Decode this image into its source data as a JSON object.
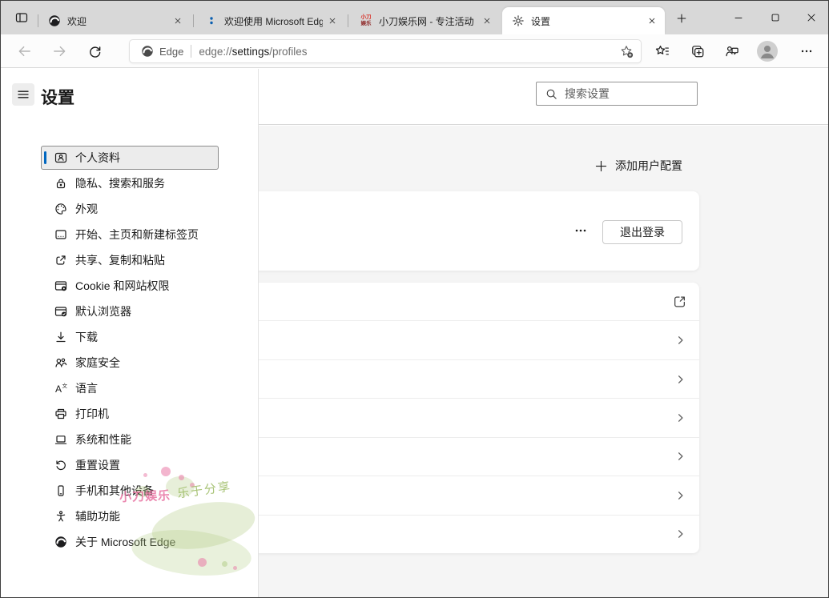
{
  "browser": {
    "tab_actions_icon": "tab-actions-icon",
    "tabs": [
      {
        "title": "欢迎",
        "icon": "edge-logo-icon",
        "active": false
      },
      {
        "title": "欢迎使用 Microsoft Edg",
        "icon": "blue-dots-favicon",
        "active": false
      },
      {
        "title": "小刀娱乐网 - 专注活动",
        "icon": "xiaodao-favicon",
        "favicon_top": "小刀",
        "favicon_bottom": "娱乐",
        "active": false
      },
      {
        "title": "设置",
        "icon": "gear-icon",
        "active": true
      }
    ],
    "window_controls": [
      {
        "name": "minimize-icon"
      },
      {
        "name": "maximize-icon"
      },
      {
        "name": "close-icon"
      }
    ],
    "address": {
      "back_icon": "back-arrow-icon",
      "forward_icon": "forward-arrow-icon",
      "refresh_icon": "refresh-icon",
      "site_icon": "edge-logo-icon",
      "site_label": "Edge",
      "url_prefix": "edge://",
      "url_emphasis": "settings",
      "url_suffix": "/profiles",
      "add_favorite_icon": "star-plus-icon"
    },
    "toolbar_icons": [
      {
        "name": "favorites-icon"
      },
      {
        "name": "collections-icon"
      },
      {
        "name": "browser-essentials-icon"
      },
      {
        "name": "profile-avatar-icon"
      },
      {
        "name": "more-options-icon"
      }
    ]
  },
  "settings": {
    "title": "设置",
    "menu_icon": "hamburger-icon",
    "search_placeholder": "搜索设置",
    "search_icon": "search-icon",
    "nav": [
      {
        "label": "个人资料",
        "icon": "profile-card-icon",
        "selected": true
      },
      {
        "label": "隐私、搜索和服务",
        "icon": "lock-icon",
        "selected": false
      },
      {
        "label": "外观",
        "icon": "palette-icon",
        "selected": false
      },
      {
        "label": "开始、主页和新建标签页",
        "icon": "home-window-icon",
        "selected": false
      },
      {
        "label": "共享、复制和粘贴",
        "icon": "share-icon",
        "selected": false
      },
      {
        "label": "Cookie 和网站权限",
        "icon": "window-gear-icon",
        "selected": false
      },
      {
        "label": "默认浏览器",
        "icon": "window-check-icon",
        "selected": false
      },
      {
        "label": "下载",
        "icon": "download-icon",
        "selected": false
      },
      {
        "label": "家庭安全",
        "icon": "family-icon",
        "selected": false
      },
      {
        "label": "语言",
        "icon": "translate-icon",
        "selected": false
      },
      {
        "label": "打印机",
        "icon": "printer-icon",
        "selected": false
      },
      {
        "label": "系统和性能",
        "icon": "laptop-icon",
        "selected": false
      },
      {
        "label": "重置设置",
        "icon": "reset-icon",
        "selected": false
      },
      {
        "label": "手机和其他设备",
        "icon": "phone-icon",
        "selected": false
      },
      {
        "label": "辅助功能",
        "icon": "accessibility-icon",
        "selected": false
      },
      {
        "label": "关于 Microsoft Edge",
        "icon": "edge-logo-icon",
        "selected": false
      }
    ],
    "profiles_page": {
      "add_profile_label": "添加用户配置",
      "add_profile_icon": "plus-icon",
      "more_icon": "more-dots-icon",
      "sign_out_label": "退出登录",
      "rows": [
        {
          "icon": "external-link-icon"
        },
        {
          "icon": "chevron-right-icon"
        },
        {
          "icon": "chevron-right-icon"
        },
        {
          "icon": "chevron-right-icon"
        },
        {
          "icon": "chevron-right-icon"
        },
        {
          "icon": "chevron-right-icon"
        },
        {
          "icon": "chevron-right-icon"
        }
      ]
    }
  },
  "watermark": {
    "text_primary": "小刀娱乐",
    "text_secondary": "乐于分享"
  },
  "colors": {
    "accent_blue": "#0067c0",
    "tab_bar_bg": "#d8d8d8",
    "page_bg": "#f5f5f5",
    "watermark_pink": "#e6699b",
    "watermark_green": "#b0cb82"
  }
}
